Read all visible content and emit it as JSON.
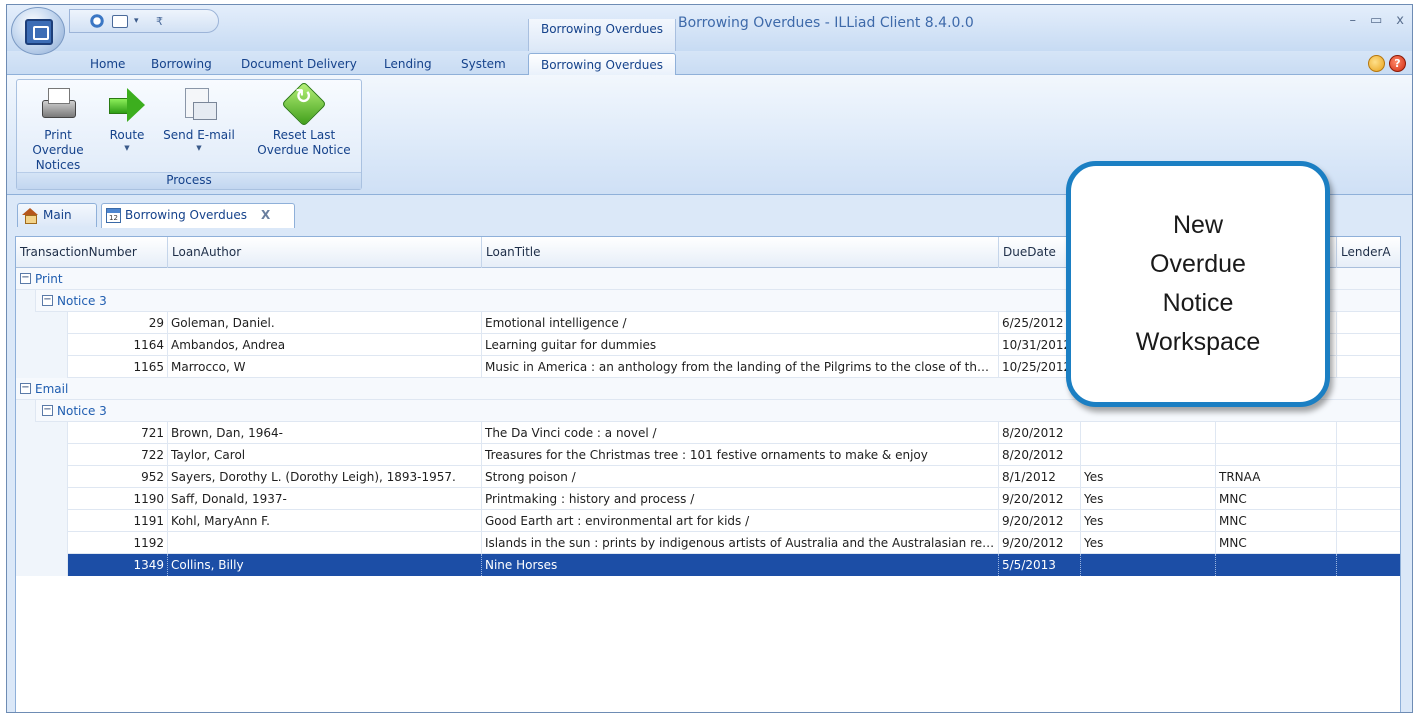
{
  "titlebar": {
    "context_group_label": "Borrowing Overdues",
    "window_title": "Borrowing Overdues - ILLiad Client 8.4.0.0",
    "minimize": "–",
    "maximize": "▭",
    "close": "x"
  },
  "ribbon_tabs": [
    "Home",
    "Borrowing",
    "Document Delivery",
    "Lending",
    "System",
    "Borrowing Overdues"
  ],
  "ribbon": {
    "group_label": "Process",
    "buttons": [
      {
        "label_line1": "Print Overdue",
        "label_line2": "Notices",
        "icon": "printer-icon"
      },
      {
        "label_line1": "Route",
        "label_line2": "",
        "icon": "green-arrow-icon",
        "dropdown": "▼"
      },
      {
        "label_line1": "Send E-mail",
        "label_line2": "",
        "icon": "email-icon",
        "dropdown": "▼"
      },
      {
        "label_line1": "Reset Last",
        "label_line2": "Overdue Notice",
        "icon": "reset-icon"
      }
    ]
  },
  "doc_tabs": {
    "main": "Main",
    "overdues": "Borrowing Overdues",
    "close": "X",
    "calendar_day": "12"
  },
  "grid": {
    "columns": [
      "TransactionNumber",
      "LoanAuthor",
      "LoanTitle",
      "DueDate",
      "",
      "",
      "LenderA"
    ],
    "groups": [
      {
        "toggle": "−",
        "label": "Print"
      },
      {
        "toggle": "−",
        "label": "Notice 3"
      },
      {
        "toggle": "−",
        "label": "Email"
      },
      {
        "toggle": "−",
        "label": "Notice 3"
      }
    ],
    "rows": [
      {
        "num": "29",
        "author": "Goleman, Daniel.",
        "title": "Emotional intelligence /",
        "due": "6/25/2012",
        "c5": "",
        "c6": "",
        "c7": ""
      },
      {
        "num": "1164",
        "author": "Ambandos, Andrea",
        "title": "Learning guitar for dummies",
        "due": "10/31/2012",
        "c5": "",
        "c6": "",
        "c7": ""
      },
      {
        "num": "1165",
        "author": "Marrocco, W",
        "title": "Music in America : an anthology from the landing of the Pilgrims to the close of the Civil War",
        "due": "10/25/2012",
        "c5": "",
        "c6": "",
        "c7": ""
      },
      {
        "num": "721",
        "author": "Brown, Dan, 1964-",
        "title": "The Da Vinci code : a novel /",
        "due": "8/20/2012",
        "c5": "",
        "c6": "",
        "c7": ""
      },
      {
        "num": "722",
        "author": "Taylor, Carol",
        "title": "Treasures for the Christmas tree : 101 festive ornaments to make & enjoy",
        "due": "8/20/2012",
        "c5": "",
        "c6": "",
        "c7": ""
      },
      {
        "num": "952",
        "author": "Sayers, Dorothy L. (Dorothy Leigh), 1893-1957.",
        "title": "Strong poison /",
        "due": "8/1/2012",
        "c5": "Yes",
        "c6": "TRNAA",
        "c7": ""
      },
      {
        "num": "1190",
        "author": "Saff, Donald, 1937-",
        "title": "Printmaking : history and process /",
        "due": "9/20/2012",
        "c5": "Yes",
        "c6": "MNC",
        "c7": ""
      },
      {
        "num": "1191",
        "author": "Kohl, MaryAnn F.",
        "title": "Good Earth art : environmental art for kids /",
        "due": "9/20/2012",
        "c5": "Yes",
        "c6": "MNC",
        "c7": ""
      },
      {
        "num": "1192",
        "author": "",
        "title": "Islands in the sun : prints by indigenous artists of Australia and the Australasian region",
        "due": "9/20/2012",
        "c5": "Yes",
        "c6": "MNC",
        "c7": ""
      },
      {
        "num": "1349",
        "author": "Collins, Billy",
        "title": "Nine Horses",
        "due": "5/5/2013",
        "c5": "",
        "c6": "",
        "c7": ""
      }
    ]
  },
  "callout": {
    "line1": "New",
    "line2": "Overdue",
    "line3": "Notice",
    "line4": "Workspace"
  },
  "colors": {
    "selection": "#1c4ea6",
    "callout_border": "#1b7fc3",
    "group_label": "#1f5db0"
  }
}
